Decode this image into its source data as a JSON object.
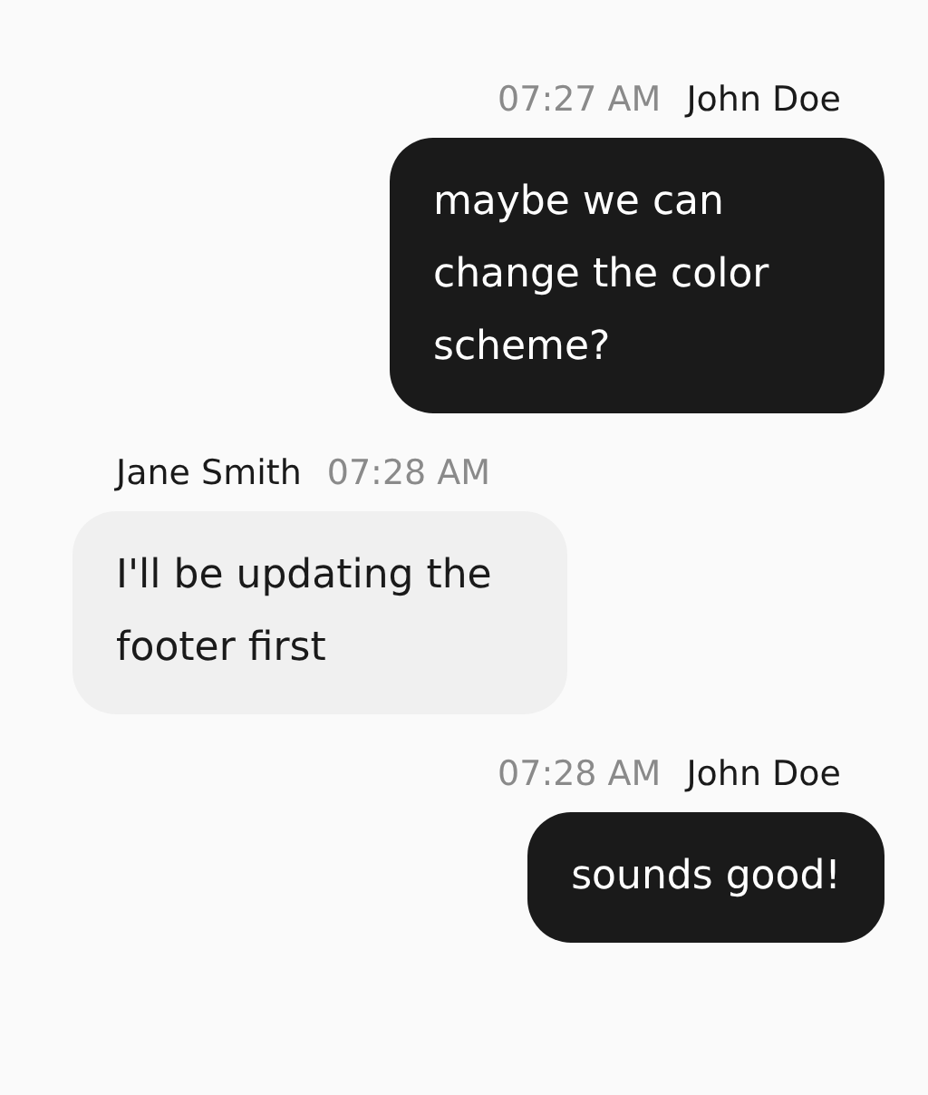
{
  "messages": [
    {
      "kind": "outgoing",
      "time": "07:27 AM",
      "author": "John Doe",
      "text": "maybe we can change the color scheme?"
    },
    {
      "kind": "incoming",
      "time": "07:28 AM",
      "author": "Jane Smith",
      "text": "I'll be updating the footer first"
    },
    {
      "kind": "outgoing",
      "time": "07:28 AM",
      "author": "John Doe",
      "text": "sounds good!"
    }
  ]
}
